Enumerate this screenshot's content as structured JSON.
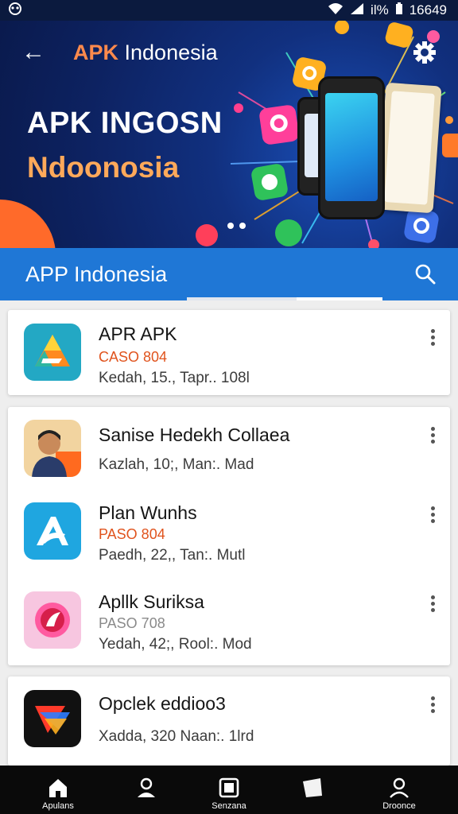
{
  "status": {
    "time": "16649",
    "battery_label": "il%"
  },
  "header": {
    "back_label": "←",
    "app_title_accent": "APK",
    "app_title_rest": " Indonesia",
    "hero_line1": "APK INGOSN",
    "hero_line2": "Ndoonosia"
  },
  "appbar": {
    "title": "APP Indonesia"
  },
  "items": [
    {
      "title": "APR APK",
      "sub": "CASO 804",
      "meta": "Kedah, 15., Tapr.. 108l"
    },
    {
      "title": "Sanise Hedekh Collaea",
      "sub": "",
      "meta": "Kazlah, 10;, Man:. Mad"
    },
    {
      "title": "Plan Wunhs",
      "sub": "PASO 804",
      "meta": "Paedh, 22,, Tan:. Mutl"
    },
    {
      "title": "Apllk Suriksa",
      "sub": "PASO 708",
      "meta": "Yedah, 42;, Rool:. Mod"
    },
    {
      "title": "Opclek eddioo3",
      "sub": "",
      "meta": "Xadda, 320 Naan:. 1lrd"
    }
  ],
  "nav": [
    {
      "label": "Apulans",
      "icon": "home-icon"
    },
    {
      "label": "",
      "icon": "person-icon"
    },
    {
      "label": "Senzana",
      "icon": "square-icon"
    },
    {
      "label": "",
      "icon": "tag-icon"
    },
    {
      "label": "Droonce",
      "icon": "profile-icon"
    }
  ],
  "colors": {
    "appbar": "#1f77d6",
    "accent": "#e0531d",
    "hero_accent": "#ffa95a"
  }
}
